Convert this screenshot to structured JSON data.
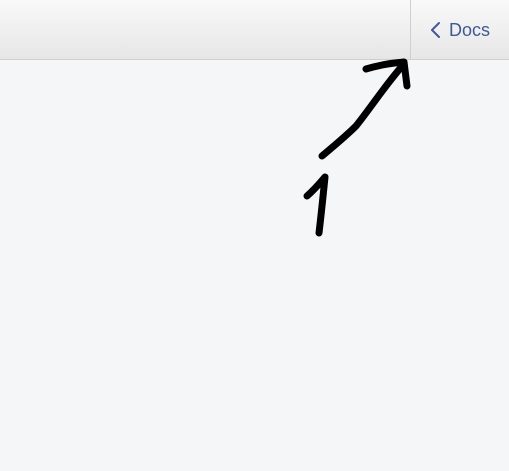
{
  "toolbar": {
    "back_button": {
      "label": "Docs",
      "icon": "chevron-left-icon",
      "color": "#3f5a96"
    }
  },
  "annotation": {
    "step_number": "1",
    "color": "#000000"
  }
}
